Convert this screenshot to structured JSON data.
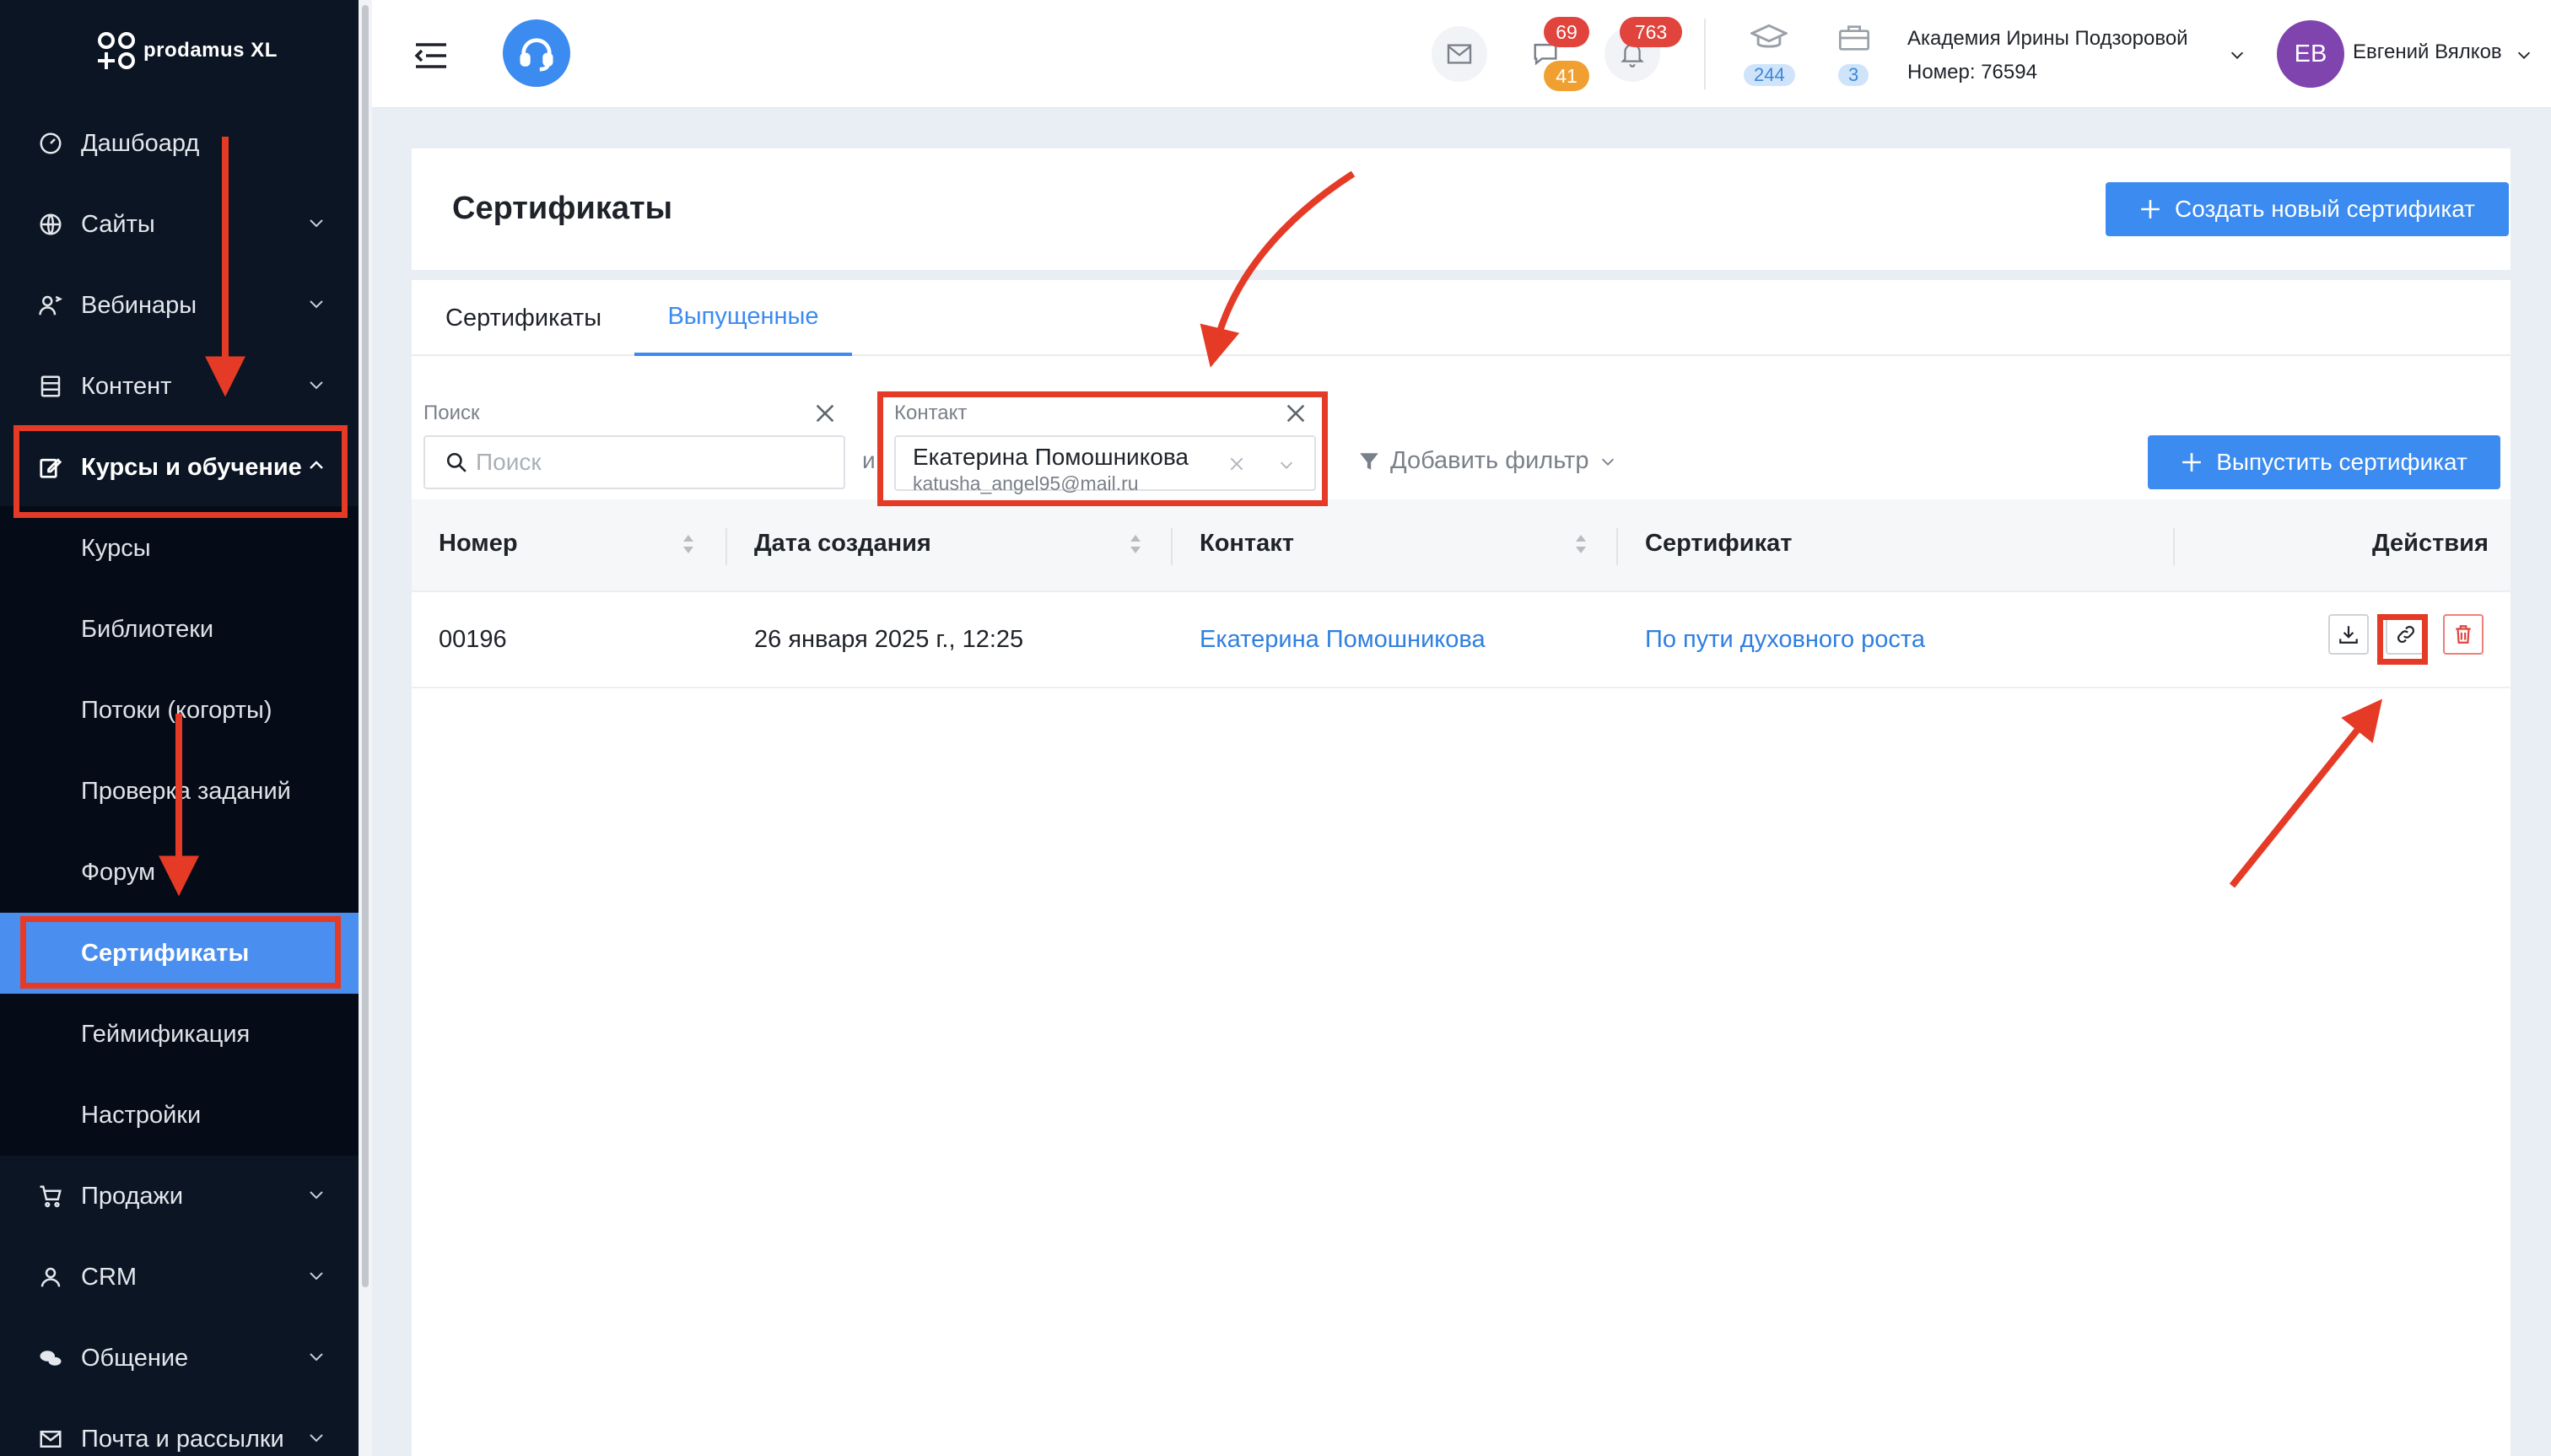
{
  "brand": {
    "name": "prodamus XL"
  },
  "sidebar": {
    "items": [
      {
        "label": "Дашбоард",
        "icon": "gauge-icon"
      },
      {
        "label": "Сайты",
        "icon": "globe-icon"
      },
      {
        "label": "Вебинары",
        "icon": "webinar-icon"
      },
      {
        "label": "Контент",
        "icon": "content-icon"
      },
      {
        "label": "Курсы и обучение",
        "icon": "edit-icon"
      },
      {
        "label": "Продажи",
        "icon": "cart-icon"
      },
      {
        "label": "CRM",
        "icon": "user-icon"
      },
      {
        "label": "Общение",
        "icon": "chat-icon"
      },
      {
        "label": "Почта и рассылки",
        "icon": "mail-icon"
      }
    ],
    "submenu": [
      "Курсы",
      "Библиотеки",
      "Потоки (когорты)",
      "Проверка заданий",
      "Форум",
      "Сертификаты",
      "Геймификация",
      "Настройки"
    ],
    "selected_submenu": "Сертификаты"
  },
  "topbar": {
    "chat_badge": "69",
    "chat_badge_secondary": "41",
    "notifications_badge": "763",
    "students_count": "244",
    "cases_count": "3",
    "account_name": "Академия Ирины Подзоровой",
    "account_number": "Номер: 76594",
    "avatar_initials": "ЕВ",
    "user_name": "Евгений Вялков"
  },
  "page": {
    "title": "Сертификаты",
    "create_button": "Создать новый сертификат",
    "tabs": [
      "Сертификаты",
      "Выпущенные"
    ],
    "active_tab": "Выпущенные"
  },
  "filters": {
    "search_label": "Поиск",
    "search_placeholder": "Поиск",
    "and_text": "и",
    "contact_label": "Контакт",
    "contact_name": "Екатерина Помошникова",
    "contact_email": "katusha_angel95@mail.ru",
    "add_filter": "Добавить фильтр",
    "issue_button": "Выпустить сертификат"
  },
  "table": {
    "columns": [
      "Номер",
      "Дата создания",
      "Контакт",
      "Сертификат",
      "Действия"
    ],
    "rows": [
      {
        "number": "00196",
        "created": "26 января 2025 г., 12:25",
        "contact": "Екатерина Помошникова",
        "certificate": "По пути духовного роста"
      }
    ]
  },
  "colors": {
    "accent": "#3b8bf0",
    "sidebar": "#0c1524",
    "highlight": "#e53a26"
  }
}
